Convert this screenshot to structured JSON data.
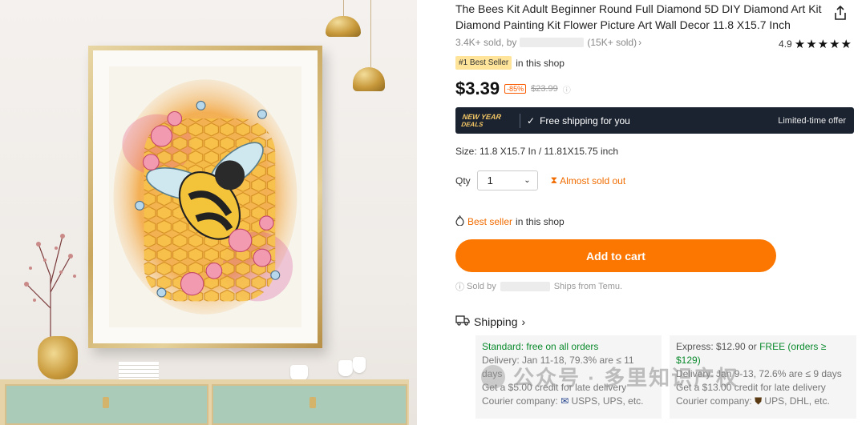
{
  "product": {
    "title": "The Bees Kit Adult Beginner Round Full Diamond 5D DIY Diamond Art Kit Diamond Painting Kit Flower Picture Art Wall Decor 11.8 X15.7 Inch",
    "sold_prefix": "3.4K+ sold, by",
    "seller_sold": "(15K+ sold)",
    "rating": "4.9",
    "stars": 5,
    "best_seller_badge": "#1 Best Seller",
    "best_seller_suffix": "in this shop",
    "price": "$3.39",
    "discount": "-85%",
    "original_price": "$23.99"
  },
  "promo": {
    "tag_line1": "NEW YEAR",
    "tag_line2": "DEALS",
    "text": "Free shipping for you",
    "limited": "Limited-time offer"
  },
  "size": {
    "text": "Size: 11.8 X15.7 In / 11.81X15.75 inch"
  },
  "qty": {
    "label": "Qty",
    "value": "1",
    "almost_sold_out": "Almost sold out"
  },
  "bestseller": {
    "highlight": "Best seller",
    "suffix": "in this shop"
  },
  "cart": {
    "label": "Add to cart"
  },
  "sold_by": {
    "prefix": "Sold by",
    "suffix": "Ships from Temu."
  },
  "shipping": {
    "label": "Shipping",
    "standard": {
      "title": "Standard: free on all orders",
      "delivery": "Delivery: Jan 11-18, 79.3% are ≤ 11 days",
      "credit": "Get a $5.00 credit for late delivery",
      "courier": "Courier company:",
      "couriers": "USPS,  UPS, etc."
    },
    "express": {
      "title_prefix": "Express: $12.90 or",
      "title_free": "FREE (orders ≥ $129)",
      "delivery": "Delivery: Jan 9-13, 72.6% are ≤ 9 days",
      "credit": "Get a $13.00 credit for late delivery",
      "courier": "Courier company:",
      "couriers": "UPS,  DHL, etc."
    }
  },
  "watermark": {
    "text": "公众号 · 多里知识产权"
  },
  "colors": {
    "accent": "#fb7701",
    "promo_bg": "#1b2331",
    "green": "#0a8a2c"
  }
}
